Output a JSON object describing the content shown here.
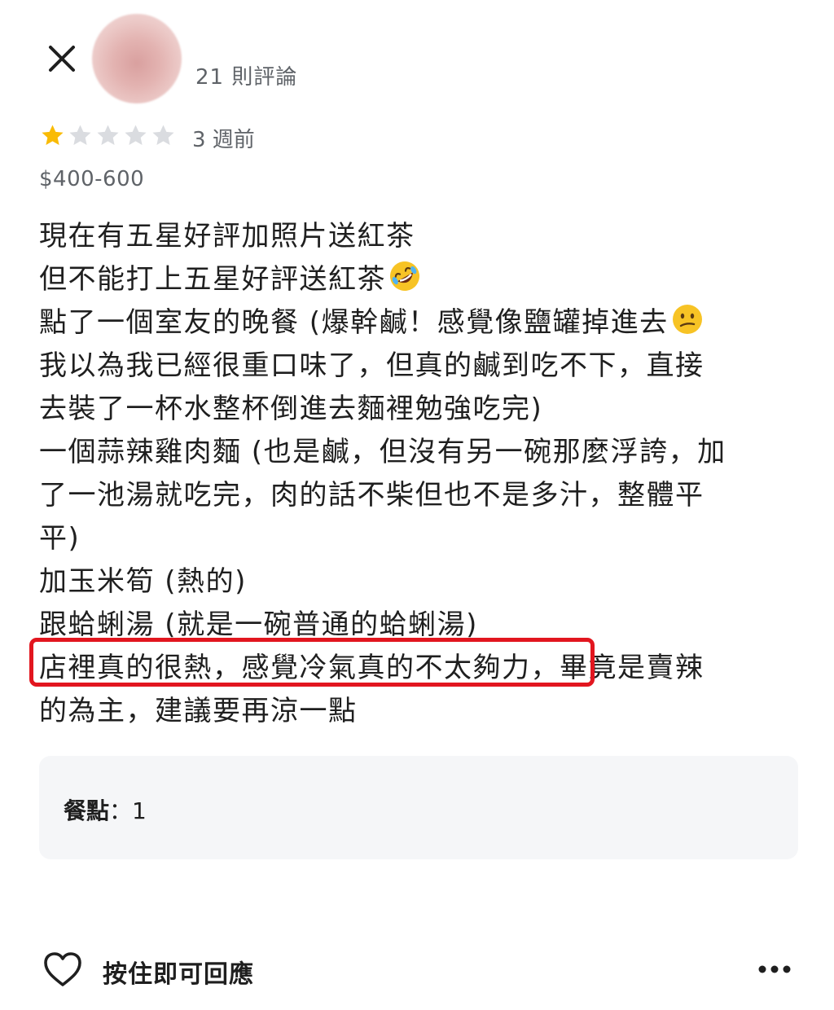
{
  "header": {
    "review_count": "21 則評論"
  },
  "review": {
    "rating": 1,
    "max_rating": 5,
    "time_ago": "3 週前",
    "price": "$400-600",
    "lines": [
      "現在有五星好評加照片送紅茶",
      "但不能打上五星好評送紅茶",
      "點了一個室友的晚餐 (爆幹鹹！感覺像鹽罐掉進去",
      "我以為我已經很重口味了，但真的鹹到吃不下，直接",
      "去裝了一杯水整杯倒進去麵裡勉強吃完)",
      "一個蒜辣雞肉麵 (也是鹹，但沒有另一碗那麼浮誇，加",
      "了一池湯就吃完，肉的話不柴但也不是多汁，整體平",
      "平)",
      "加玉米筍 (熱的)",
      "跟蛤蜊湯 (就是一碗普通的蛤蜊湯)",
      "店裡真的很熱，感覺冷氣真的不太夠力，畢竟是賣辣",
      "的為主，建議要再涼一點"
    ],
    "emojis": {
      "line_2": "rolling-on-floor-laughing-emoji",
      "line_3": "confused-face-emoji"
    }
  },
  "attributes": {
    "label": "餐點",
    "separator": "：",
    "value": "1"
  },
  "footer": {
    "hold_to_reply": "按住即可回應"
  },
  "colors": {
    "star_filled": "#f9bb05",
    "star_empty": "#dadce0",
    "highlight": "#e2161f",
    "secondary_text": "#5f6368",
    "card_bg": "#f5f6f8"
  },
  "icons": {
    "close": "close-icon",
    "heart": "heart-outline-icon",
    "more": "more-horizontal-icon"
  }
}
